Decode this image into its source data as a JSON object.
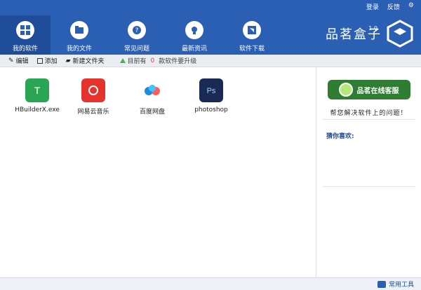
{
  "top_links": {
    "login": "登录",
    "feedback": "反馈",
    "settings_symbol": "⚙"
  },
  "nav": [
    {
      "label": "我的软件"
    },
    {
      "label": "我的文件"
    },
    {
      "label": "常见问题"
    },
    {
      "label": "最新资讯"
    },
    {
      "label": "软件下载"
    }
  ],
  "brand": {
    "name": "品茗盒子",
    "version": "1.0"
  },
  "toolbar": {
    "edit": "编辑",
    "add": "添加",
    "new_folder": "新建文件夹",
    "upgrade_prefix": "目前有",
    "upgrade_count": "0",
    "upgrade_suffix": "款软件要升级"
  },
  "apps": [
    {
      "name": "HBuilderX.exe",
      "color": "#2aa553"
    },
    {
      "name": "网易云音乐",
      "color": "#e5322d"
    },
    {
      "name": "百度网盘",
      "color": "#ffffff"
    },
    {
      "name": "photoshop",
      "color": "#1b2a55"
    }
  ],
  "right_panel": {
    "service_btn": "品茗在线客服",
    "help_text": "帮您解决软件上的问题！",
    "guess_label": "猜你喜欢:"
  },
  "status": {
    "tools_label": "常用工具"
  }
}
